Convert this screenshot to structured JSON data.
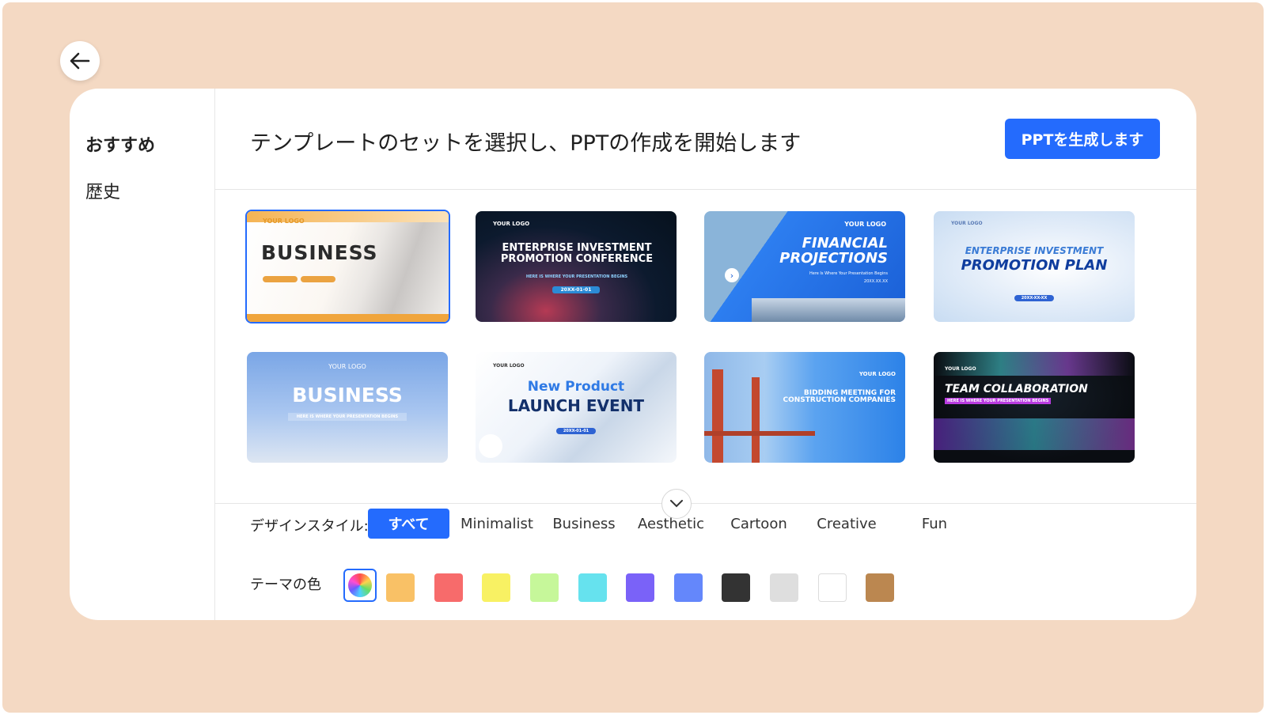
{
  "back_icon": "arrow-left-icon",
  "sidebar": {
    "items": [
      {
        "label": "おすすめ"
      },
      {
        "label": "歴史"
      }
    ]
  },
  "header": {
    "title": "テンプレートのセットを選択し、PPTの作成を開始します",
    "generate_label": "PPTを生成します"
  },
  "templates": [
    {
      "logo": "YOUR LOGO",
      "title": "BUSINESS",
      "selected": true
    },
    {
      "logo": "YOUR LOGO",
      "title": "ENTERPRISE INVESTMENT PROMOTION CONFERENCE",
      "sub": "HERE IS WHERE YOUR PRESENTATION BEGINS",
      "date": "20XX-01-01"
    },
    {
      "logo": "YOUR LOGO",
      "title": "FINANCIAL PROJECTIONS",
      "sub": "Here Is Where Your Presentation Begins",
      "date": "20XX.XX.XX"
    },
    {
      "logo": "YOUR LOGO",
      "title_line1": "ENTERPRISE INVESTMENT",
      "title_line2": "PROMOTION PLAN",
      "date": "20XX-XX-XX"
    },
    {
      "logo": "YOUR LOGO",
      "title": "BUSINESS",
      "sub": "HERE IS WHERE YOUR PRESENTATION BEGINS"
    },
    {
      "logo": "YOUR LOGO",
      "title_line1": "New Product",
      "title_line2": "LAUNCH EVENT",
      "date": "20XX-01-01"
    },
    {
      "logo": "YOUR LOGO",
      "title": "BIDDING MEETING FOR CONSTRUCTION COMPANIES"
    },
    {
      "logo": "YOUR LOGO",
      "title": "TEAM COLLABORATION",
      "sub": "HERE IS WHERE YOUR PRESENTATION BEGINS"
    }
  ],
  "filters": {
    "style_label": "デザインスタイル:",
    "styles": [
      "すべて",
      "Minimalist",
      "Business",
      "Aesthetic",
      "Cartoon",
      "Creative",
      "Fun"
    ],
    "active_style": "すべて",
    "color_label": "テーマの色",
    "colors": [
      "#f9c166",
      "#f76b6b",
      "#f8f163",
      "#c6f79a",
      "#66e2ee",
      "#7a62f8",
      "#6487fb",
      "#333333",
      "#dedede",
      "#ffffff",
      "#bb8750"
    ]
  }
}
